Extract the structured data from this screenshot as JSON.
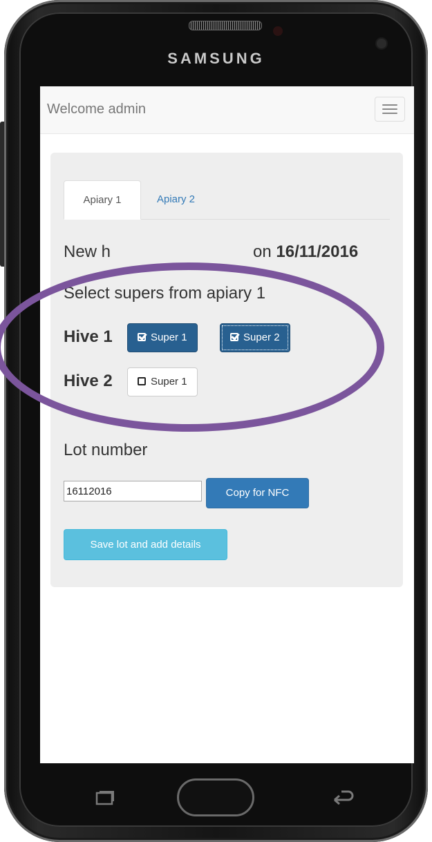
{
  "device": {
    "brand": "SAMSUNG"
  },
  "navbar": {
    "brand": "Welcome admin",
    "toggle_icon": "hamburger-icon"
  },
  "tabs": [
    {
      "label": "Apiary 1",
      "active": true
    },
    {
      "label": "Apiary 2",
      "active": false
    }
  ],
  "main": {
    "heading_prefix": "New h",
    "heading_suffix": "on",
    "heading_date": "16/11/2016",
    "select_label": "Select supers from apiary 1",
    "hives": [
      {
        "label": "Hive 1",
        "supers": [
          {
            "label": "Super 1",
            "selected": true
          },
          {
            "label": "Super 2",
            "selected": true
          }
        ]
      },
      {
        "label": "Hive 2",
        "supers": [
          {
            "label": "Super 1",
            "selected": false
          }
        ]
      }
    ],
    "lot_label": "Lot number",
    "lot_value": "16112016",
    "copy_button": "Copy for NFC",
    "save_button": "Save lot and add details"
  },
  "colors": {
    "primary": "#337ab7",
    "selected_super": "#286090",
    "info": "#5bc0de",
    "annotation": "#7b559c"
  }
}
